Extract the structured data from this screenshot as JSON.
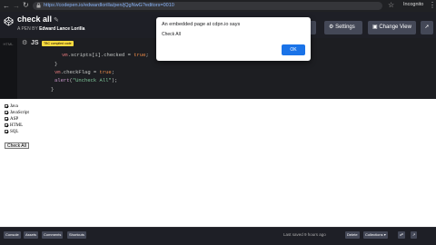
{
  "browser": {
    "url": "https://codepen.io/edwardlorilla/pen/jQgNwG?editors=0010",
    "mode_label": "Incognito"
  },
  "header": {
    "title": "check all",
    "author_prefix": "A PEN BY",
    "author_name": "Edward Lance Lorilla",
    "fork_label": "k",
    "settings_label": "Settings",
    "change_view_label": "Change View"
  },
  "editor": {
    "side_label": "HTML",
    "js_label": "JS",
    "badge": "TBC compiled code",
    "code": [
      {
        "indent": "      ",
        "parts": [
          [
            "v",
            "vm"
          ],
          [
            "t",
            ".scripts[i].checked = "
          ],
          [
            "b",
            "true"
          ],
          [
            "t",
            ";"
          ]
        ]
      },
      {
        "indent": "    ",
        "parts": [
          [
            "t",
            "}"
          ]
        ]
      },
      {
        "indent": "    ",
        "parts": [
          [
            "v",
            "vm"
          ],
          [
            "t",
            ".checkFlag = "
          ],
          [
            "b",
            "true"
          ],
          [
            "t",
            ";"
          ]
        ]
      },
      {
        "indent": "    ",
        "parts": [
          [
            "k",
            "alert"
          ],
          [
            "t",
            "("
          ],
          [
            "s",
            "\"Uncheck All\""
          ],
          [
            "t",
            ");"
          ]
        ]
      },
      {
        "indent": "  ",
        "parts": [
          [
            "t",
            "}"
          ]
        ]
      }
    ]
  },
  "preview": {
    "items": [
      "Java",
      "JavaScript",
      "ASP",
      "HTML",
      "SQL"
    ],
    "button_label": "Check All"
  },
  "footer": {
    "tabs": [
      "Console",
      "Assets",
      "Comments",
      "Shortcuts"
    ],
    "saved": "Last saved 9 hours ago",
    "delete_label": "Delete",
    "collections_label": "Collections"
  },
  "dialog": {
    "title": "An embedded page at cdpn.io says",
    "message": "Check All",
    "ok_label": "OK"
  }
}
